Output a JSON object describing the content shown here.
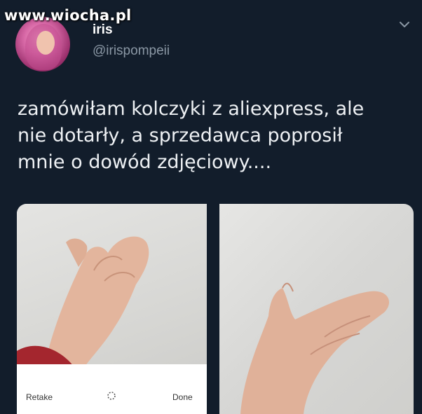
{
  "watermark": "www.wiocha.pl",
  "tweet": {
    "display_name": "iris",
    "handle": "@irispompeii",
    "text_lines": [
      "zamówiłam kolczyki z aliexpress, ale",
      "nie dotarły, a sprzedawca poprosił",
      "mnie o dowód zdjęciowy...."
    ]
  },
  "camera_bar": {
    "retake_label": "Retake",
    "done_label": "Done"
  },
  "icons": {
    "more": "chevron-down-icon",
    "loading": "spinner-icon"
  },
  "colors": {
    "background": "#121d2b",
    "text": "#eef1f4",
    "secondary_text": "#8b98a5"
  }
}
